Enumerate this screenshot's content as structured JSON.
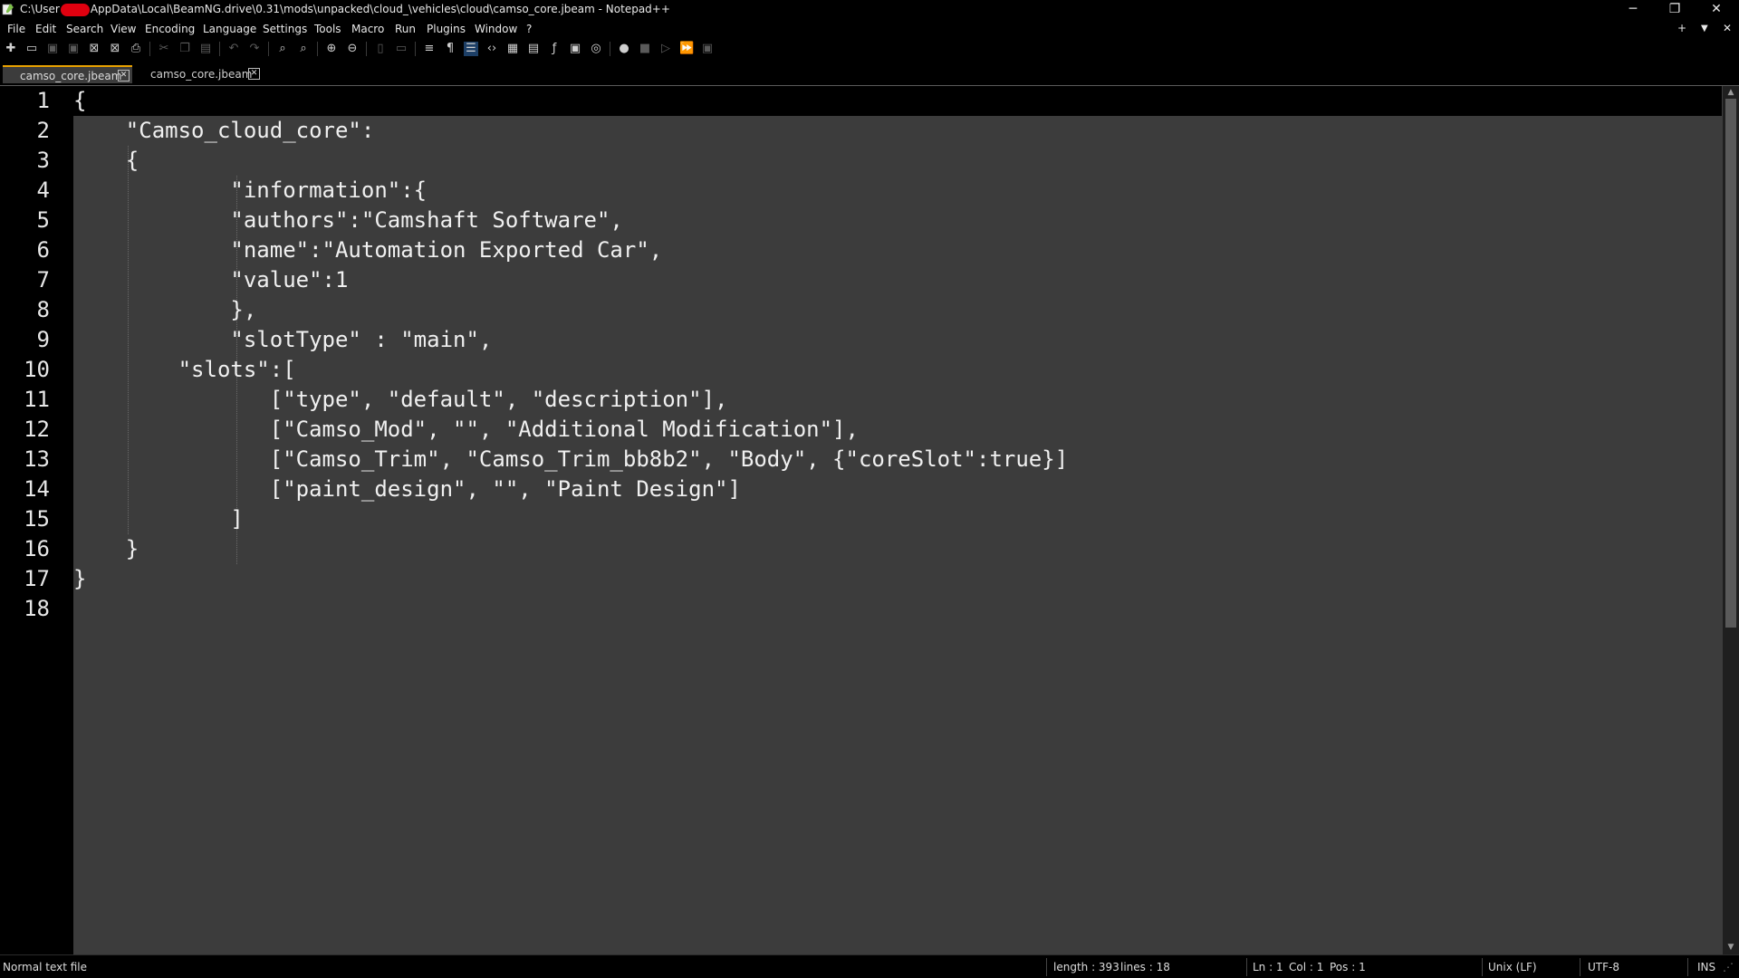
{
  "window": {
    "title_prefix": "C:\\User",
    "title_suffix": "AppData\\Local\\BeamNG.drive\\0.31\\mods\\unpacked\\cloud_\\vehicles\\cloud\\camso_core.jbeam - Notepad++",
    "controls": {
      "minimize": "─",
      "restore": "❐",
      "close": "✕"
    }
  },
  "menu": {
    "items": [
      "File",
      "Edit",
      "Search",
      "View",
      "Encoding",
      "Language",
      "Settings",
      "Tools",
      "Macro",
      "Run",
      "Plugins",
      "Window",
      "?"
    ],
    "right_icons": {
      "add": "+",
      "dropdown": "▼",
      "close": "✕"
    }
  },
  "tabs": [
    {
      "label": "camso_core.jbeam",
      "active": true
    },
    {
      "label": "camso_core.jbeam",
      "active": false
    }
  ],
  "editor": {
    "line_numbers": [
      "1",
      "2",
      "3",
      "4",
      "5",
      "6",
      "7",
      "8",
      "9",
      "10",
      "11",
      "12",
      "13",
      "14",
      "15",
      "16",
      "17",
      "18"
    ],
    "lines": [
      "{",
      "    \"Camso_cloud_core\":",
      "    {",
      "        \t\"information\":{",
      "        \t\"authors\":\"Camshaft Software\",",
      "        \t\"name\":\"Automation Exported Car\",",
      "        \t\"value\":1",
      "        \t},",
      "        \t\"slotType\" : \"main\",",
      "        \"slots\":[",
      "        \t   [\"type\", \"default\", \"description\"],",
      "        \t   [\"Camso_Mod\", \"\", \"Additional Modification\"],",
      "        \t   [\"Camso_Trim\", \"Camso_Trim_bb8b2\", \"Body\", {\"coreSlot\":true}]",
      "        \t   [\"paint_design\", \"\", \"Paint Design\"]",
      "        \t]",
      "    }",
      "}",
      ""
    ]
  },
  "statusbar": {
    "file_type": "Normal text file",
    "length": "length : 393",
    "lines": "lines : 18",
    "ln": "Ln : 1",
    "col": "Col : 1",
    "pos": "Pos : 1",
    "eol": "Unix (LF)",
    "encoding": "UTF-8",
    "mode": "INS"
  },
  "colors": {
    "editor_bg": "#3c3c3c",
    "gutter_bg": "#000000",
    "active_tab_accent": "#e8a100",
    "redaction": "#e0000f"
  }
}
